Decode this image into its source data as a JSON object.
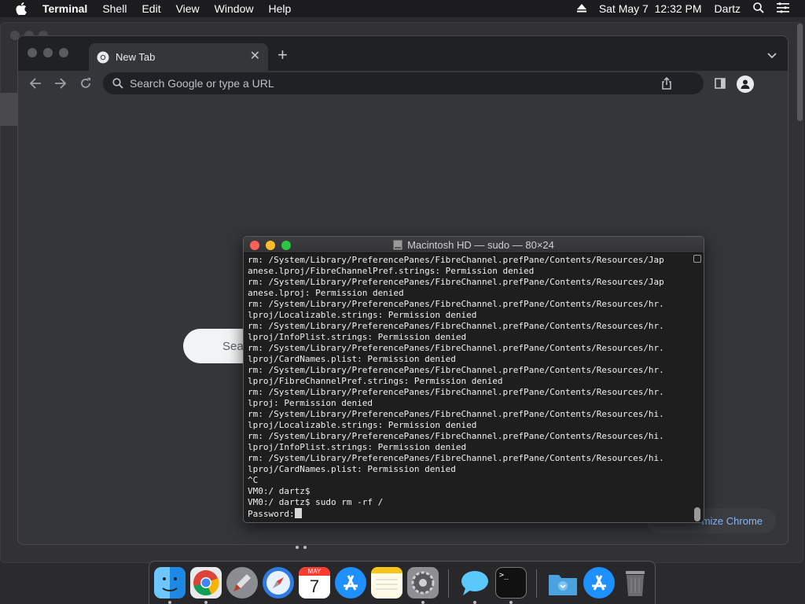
{
  "menubar": {
    "app_name": "Terminal",
    "items": [
      "Shell",
      "Edit",
      "View",
      "Window",
      "Help"
    ],
    "datetime": "Sat May 7  12:32 PM",
    "user": "Dartz"
  },
  "chrome": {
    "tab_title": "New Tab",
    "omnibox_placeholder": "Search Google or type a URL",
    "ntp_search_text": "Sea",
    "customize_label": "mize Chrome"
  },
  "terminal": {
    "title": "Macintosh HD — sudo — 80×24",
    "lines": [
      "rm: /System/Library/PreferencePanes/FibreChannel.prefPane/Contents/Resources/Jap",
      "anese.lproj/FibreChannelPref.strings: Permission denied",
      "rm: /System/Library/PreferencePanes/FibreChannel.prefPane/Contents/Resources/Jap",
      "anese.lproj: Permission denied",
      "rm: /System/Library/PreferencePanes/FibreChannel.prefPane/Contents/Resources/hr.",
      "lproj/Localizable.strings: Permission denied",
      "rm: /System/Library/PreferencePanes/FibreChannel.prefPane/Contents/Resources/hr.",
      "lproj/InfoPlist.strings: Permission denied",
      "rm: /System/Library/PreferencePanes/FibreChannel.prefPane/Contents/Resources/hr.",
      "lproj/CardNames.plist: Permission denied",
      "rm: /System/Library/PreferencePanes/FibreChannel.prefPane/Contents/Resources/hr.",
      "lproj/FibreChannelPref.strings: Permission denied",
      "rm: /System/Library/PreferencePanes/FibreChannel.prefPane/Contents/Resources/hr.",
      "lproj: Permission denied",
      "rm: /System/Library/PreferencePanes/FibreChannel.prefPane/Contents/Resources/hi.",
      "lproj/Localizable.strings: Permission denied",
      "rm: /System/Library/PreferencePanes/FibreChannel.prefPane/Contents/Resources/hi.",
      "lproj/InfoPlist.strings: Permission denied",
      "rm: /System/Library/PreferencePanes/FibreChannel.prefPane/Contents/Resources/hi.",
      "lproj/CardNames.plist: Permission denied",
      "^C",
      "VM0:/ dartz$",
      "VM0:/ dartz$ sudo rm -rf /"
    ],
    "password_prompt": "Password:"
  },
  "dock": {
    "apps": [
      "finder-icon",
      "chrome-icon",
      "launchpad-icon",
      "safari-icon",
      "calendar-icon",
      "app-store-icon",
      "notes-icon",
      "system-preferences-icon",
      "messages-icon",
      "terminal-icon",
      "downloads-folder-icon",
      "app-store-download-icon",
      "trash-icon"
    ],
    "calendar_month": "MAY",
    "calendar_day": "7"
  },
  "colors": {
    "terminal_bg": "#1e1e1e",
    "close_red": "#fe5f57",
    "minimize_yellow": "#febc2e",
    "zoom_green": "#28c840",
    "chrome_accent": "#8ab4f8"
  }
}
